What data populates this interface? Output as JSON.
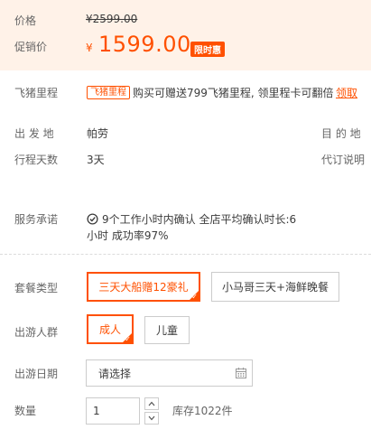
{
  "price": {
    "label": "价格",
    "original": "¥2599.00",
    "promo_label": "促销价",
    "currency": "¥",
    "sale": "1599.00",
    "badge": "限时惠"
  },
  "miles": {
    "label": "飞猪里程",
    "badge": "飞猪里程",
    "text": "购买可赠送799飞猪里程, 领里程卡可翻倍",
    "link": "领取"
  },
  "departure": {
    "label": "出 发 地",
    "value": "帕劳",
    "right": "目 的 地"
  },
  "duration": {
    "label": "行程天数",
    "value": "3天",
    "right": "代订说明"
  },
  "promise": {
    "label": "服务承诺",
    "line1": "9个工作小时内确认 全店平均确认时长:6",
    "line2": "小时 成功率97%"
  },
  "package": {
    "label": "套餐类型",
    "options": [
      "三天大船赠12豪礼",
      "小马哥三天+海鲜晚餐"
    ]
  },
  "travelers": {
    "label": "出游人群",
    "options": [
      "成人",
      "儿童"
    ]
  },
  "date": {
    "label": "出游日期",
    "placeholder": "请选择"
  },
  "quantity": {
    "label": "数量",
    "value": "1",
    "stock": "库存1022件"
  },
  "colors": {
    "accent": "#ff5000",
    "price_bg": "#fff2e8"
  }
}
